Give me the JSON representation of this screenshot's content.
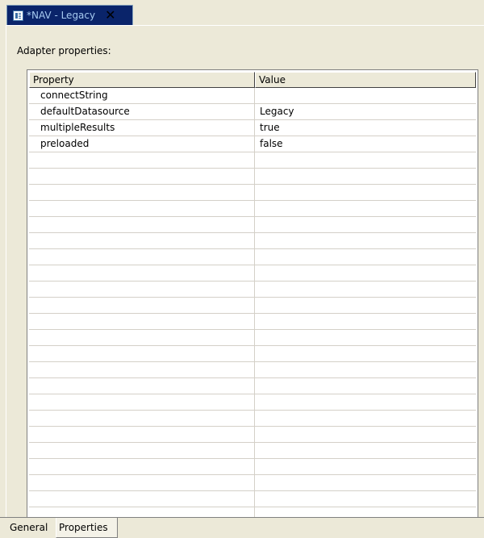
{
  "editor_tab": {
    "icon": "table-icon",
    "label": "*NAV - Legacy",
    "close_glyph": "✕"
  },
  "section": {
    "label": "Adapter properties:"
  },
  "table": {
    "columns": [
      "Property",
      "Value"
    ],
    "rows": [
      [
        "connectString",
        ""
      ],
      [
        "defaultDatasource",
        "Legacy"
      ],
      [
        "multipleResults",
        "true"
      ],
      [
        "preloaded",
        "false"
      ],
      [
        "",
        ""
      ],
      [
        "",
        ""
      ],
      [
        "",
        ""
      ],
      [
        "",
        ""
      ],
      [
        "",
        ""
      ],
      [
        "",
        ""
      ],
      [
        "",
        ""
      ],
      [
        "",
        ""
      ],
      [
        "",
        ""
      ],
      [
        "",
        ""
      ],
      [
        "",
        ""
      ],
      [
        "",
        ""
      ],
      [
        "",
        ""
      ],
      [
        "",
        ""
      ],
      [
        "",
        ""
      ],
      [
        "",
        ""
      ],
      [
        "",
        ""
      ],
      [
        "",
        ""
      ],
      [
        "",
        ""
      ],
      [
        "",
        ""
      ],
      [
        "",
        ""
      ],
      [
        "",
        ""
      ],
      [
        "",
        ""
      ]
    ]
  },
  "bottom_tabs": {
    "general": "General",
    "properties": "Properties"
  }
}
